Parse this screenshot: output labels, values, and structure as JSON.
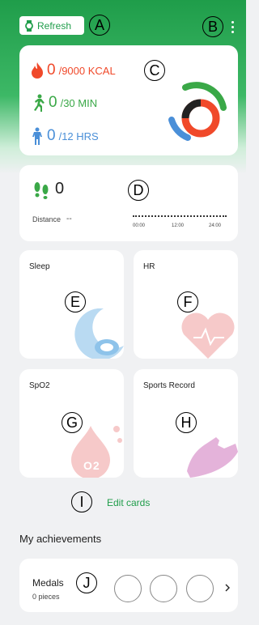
{
  "header": {
    "refresh_label": "Refresh",
    "accent": "#1f9d4a"
  },
  "annotations": [
    "A",
    "B",
    "C",
    "D",
    "E",
    "F",
    "G",
    "H",
    "I",
    "J"
  ],
  "activity": {
    "calories": {
      "value": "0",
      "goal": "/9000 KCAL",
      "color": "#f0492a",
      "icon": "flame-icon"
    },
    "exercise": {
      "value": "0",
      "goal": "/30 MIN",
      "color": "#3aa847",
      "icon": "running-person-icon"
    },
    "standing": {
      "value": "0",
      "goal": "/12 HRS",
      "color": "#4a8fd8",
      "icon": "standing-person-icon"
    }
  },
  "steps": {
    "value": "0",
    "distance_label": "Distance",
    "distance_value": "--",
    "time_labels": [
      "00:00",
      "12:00",
      "24:00"
    ]
  },
  "cards": {
    "sleep": "Sleep",
    "hr": "HR",
    "spo2": "SpO2",
    "sports": "Sports Record",
    "spo2_glyph": "O2"
  },
  "edit_cards_label": "Edit cards",
  "achievements": {
    "title": "My achievements",
    "medals_label": "Medals",
    "medals_count": "0 pieces"
  }
}
